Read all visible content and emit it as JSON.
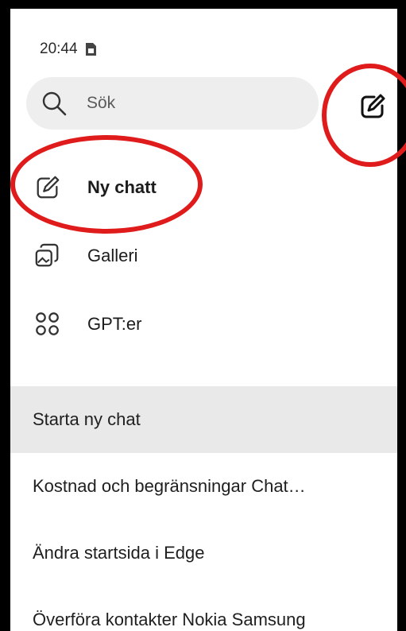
{
  "status_bar": {
    "time": "20:44",
    "icon": "sim-card-icon"
  },
  "search": {
    "placeholder": "Sök",
    "icon": "search-icon"
  },
  "compose_button": {
    "icon": "compose-icon"
  },
  "menu": [
    {
      "label": "Ny chatt",
      "icon": "compose-icon",
      "bold": true
    },
    {
      "label": "Galleri",
      "icon": "gallery-icon",
      "bold": false
    },
    {
      "label": "GPT:er",
      "icon": "grid-icon",
      "bold": false
    }
  ],
  "history": [
    {
      "label": "Starta ny chat",
      "active": true
    },
    {
      "label": "Kostnad och begränsningar Chat…",
      "active": false
    },
    {
      "label": "Ändra startsida i Edge",
      "active": false
    },
    {
      "label": "Överföra kontakter Nokia Samsung",
      "active": false
    }
  ],
  "annotation_color": "#e01b1b"
}
